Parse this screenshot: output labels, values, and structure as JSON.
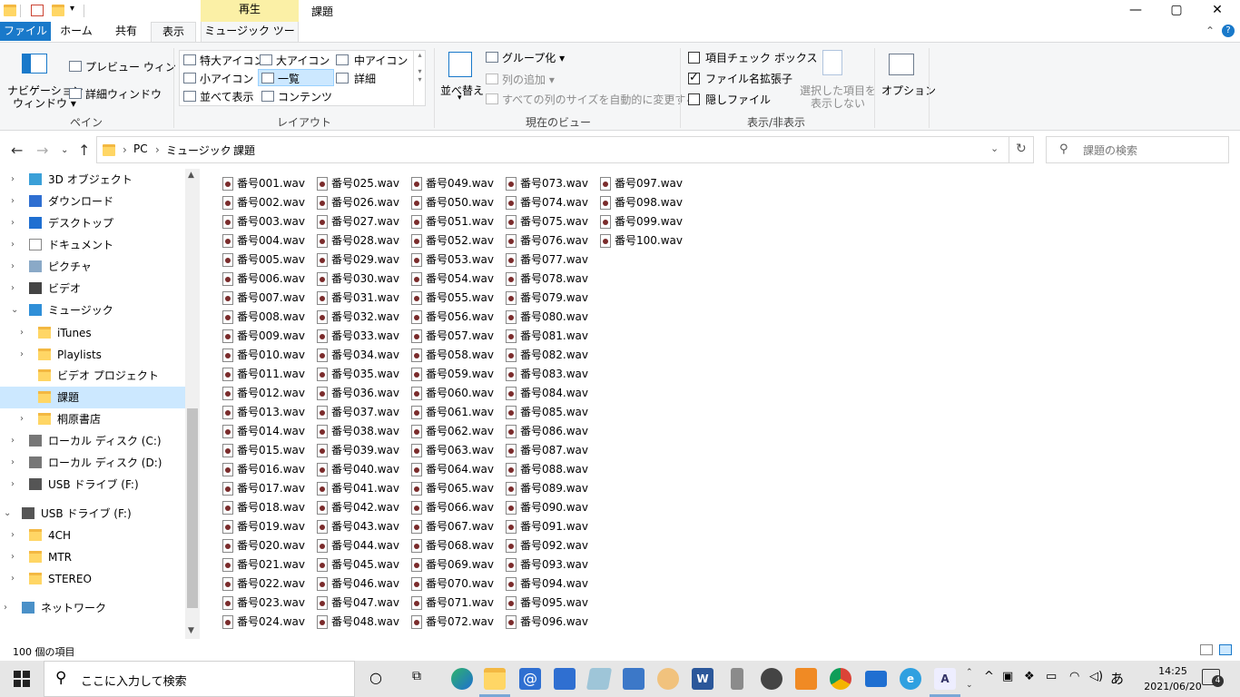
{
  "window": {
    "title": "課題",
    "context_tab_header": "再生",
    "controls": {
      "minimize": "—",
      "maximize": "▢",
      "close": "✕"
    }
  },
  "tabs": [
    {
      "label": "ファイル"
    },
    {
      "label": "ホーム"
    },
    {
      "label": "共有"
    },
    {
      "label": "表示"
    },
    {
      "label": "ミュージック ツール"
    }
  ],
  "ribbon": {
    "pane": {
      "nav_pane_line1": "ナビゲーション",
      "nav_pane_line2": "ウィンドウ",
      "preview": "プレビュー ウィンドウ",
      "details": "詳細ウィンドウ",
      "label": "ペイン"
    },
    "layout": {
      "items": [
        "特大アイコン",
        "大アイコン",
        "中アイコン",
        "小アイコン",
        "一覧",
        "詳細",
        "並べて表示",
        "コンテンツ"
      ],
      "label": "レイアウト"
    },
    "current_view": {
      "sort": "並べ替え",
      "group": "グループ化",
      "add_column": "列の追加",
      "fit_columns": "すべての列のサイズを自動的に変更する",
      "label": "現在のビュー"
    },
    "show_hide": {
      "item_checkboxes": "項目チェック ボックス",
      "file_extensions": "ファイル名拡張子",
      "hidden_items": "隠しファイル",
      "hide_selected_line1": "選択した項目を",
      "hide_selected_line2": "表示しない",
      "label": "表示/非表示"
    },
    "options": "オプション"
  },
  "address": {
    "crumbs": [
      "PC",
      "ミュージック",
      "課題"
    ],
    "search_placeholder": "課題の検索"
  },
  "nav": [
    {
      "label": "3D オブジェクト",
      "depth": 1,
      "chev": "›",
      "icon": "cube-3d"
    },
    {
      "label": "ダウンロード",
      "depth": 1,
      "chev": "›",
      "icon": "download"
    },
    {
      "label": "デスクトップ",
      "depth": 1,
      "chev": "›",
      "icon": "desktop"
    },
    {
      "label": "ドキュメント",
      "depth": 1,
      "chev": "›",
      "icon": "document"
    },
    {
      "label": "ピクチャ",
      "depth": 1,
      "chev": "›",
      "icon": "picture"
    },
    {
      "label": "ビデオ",
      "depth": 1,
      "chev": "›",
      "icon": "video"
    },
    {
      "label": "ミュージック",
      "depth": 1,
      "chev": "⌄",
      "icon": "music"
    },
    {
      "label": "iTunes",
      "depth": 2,
      "chev": "›",
      "icon": "folder"
    },
    {
      "label": "Playlists",
      "depth": 2,
      "chev": "›",
      "icon": "folder"
    },
    {
      "label": "ビデオ プロジェクト",
      "depth": 2,
      "chev": "",
      "icon": "folder"
    },
    {
      "label": "課題",
      "depth": 2,
      "chev": "",
      "icon": "folder",
      "selected": true
    },
    {
      "label": "桐原書店",
      "depth": 2,
      "chev": "›",
      "icon": "folder"
    },
    {
      "label": "ローカル ディスク (C:)",
      "depth": 1,
      "chev": "›",
      "icon": "drive"
    },
    {
      "label": "ローカル ディスク (D:)",
      "depth": 1,
      "chev": "›",
      "icon": "drive"
    },
    {
      "label": "USB ドライブ (F:)",
      "depth": 1,
      "chev": "›",
      "icon": "usb"
    },
    {
      "label": "USB ドライブ (F:)",
      "depth": 0,
      "chev": "⌄",
      "icon": "usb"
    },
    {
      "label": "4CH",
      "depth": 1,
      "chev": "›",
      "icon": "folder"
    },
    {
      "label": "MTR",
      "depth": 1,
      "chev": "›",
      "icon": "folder"
    },
    {
      "label": "STEREO",
      "depth": 1,
      "chev": "›",
      "icon": "folder"
    },
    {
      "label": "ネットワーク",
      "depth": 0,
      "chev": "›",
      "icon": "network"
    }
  ],
  "files": {
    "prefix": "番号",
    "extension": ".wav",
    "count": 100,
    "per_column": 24
  },
  "status": {
    "item_count": "100 個の項目"
  },
  "taskbar": {
    "search_placeholder": "ここに入力して検索",
    "time": "14:25",
    "date": "2021/06/20",
    "ime": "あ",
    "notifications": "4"
  },
  "colors": {
    "accent": "#1979ca",
    "folder": "#ffd665",
    "selection": "#cce8ff"
  }
}
